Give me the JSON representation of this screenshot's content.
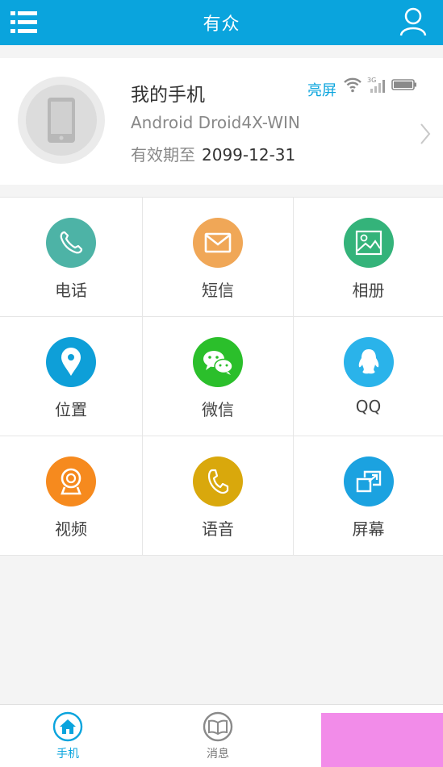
{
  "header": {
    "title": "有众"
  },
  "device": {
    "name": "我的手机",
    "model": "Android Droid4X-WIN",
    "expiry_label": "有效期至",
    "expiry_date": "2099-12-31",
    "screen_status": "亮屏",
    "network_label": "3G"
  },
  "grid": {
    "items": [
      {
        "label": "电话",
        "icon": "phone-icon",
        "color": "#4db3a6"
      },
      {
        "label": "短信",
        "icon": "mail-icon",
        "color": "#f0a757"
      },
      {
        "label": "相册",
        "icon": "photo-icon",
        "color": "#34b37a"
      },
      {
        "label": "位置",
        "icon": "location-icon",
        "color": "#0e9fd8"
      },
      {
        "label": "微信",
        "icon": "wechat-icon",
        "color": "#2bbf2b"
      },
      {
        "label": "QQ",
        "icon": "qq-icon",
        "color": "#2ab3ea"
      },
      {
        "label": "视频",
        "icon": "webcam-icon",
        "color": "#f68a1e"
      },
      {
        "label": "语音",
        "icon": "voice-icon",
        "color": "#d9a80c"
      },
      {
        "label": "屏幕",
        "icon": "screen-icon",
        "color": "#1ba2e0"
      }
    ]
  },
  "nav": {
    "phone_label": "手机",
    "messages_label": "消息"
  },
  "colors": {
    "accent": "#0aa4dd",
    "overlay": "#f28ce9"
  }
}
